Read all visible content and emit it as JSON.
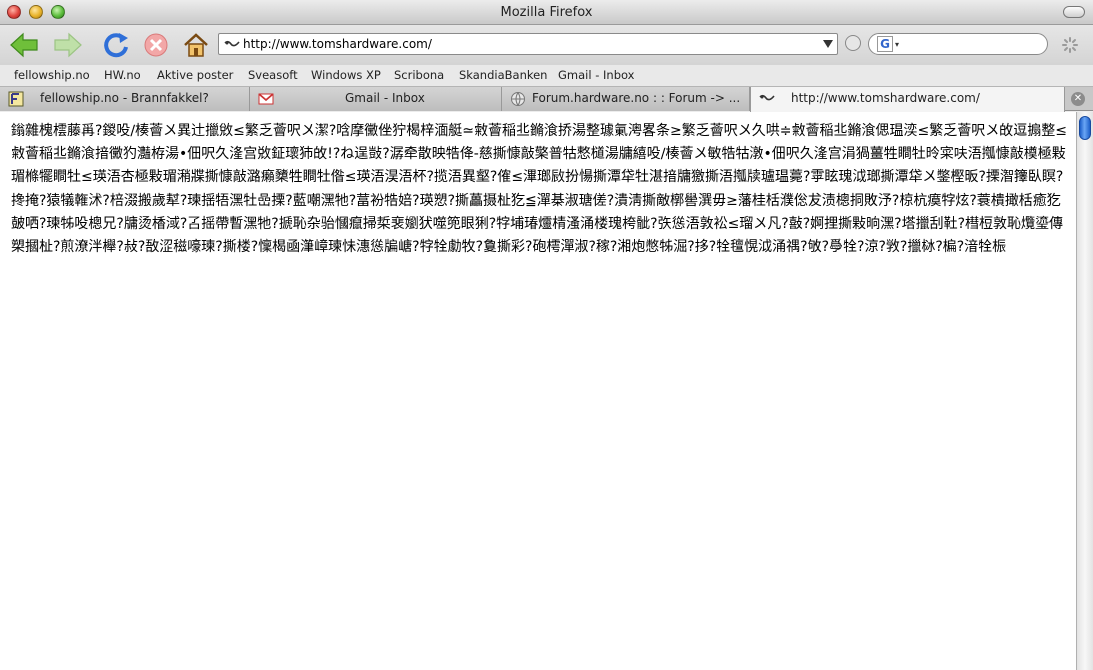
{
  "window": {
    "title": "Mozilla Firefox"
  },
  "toolbar": {
    "url": "http://www.tomshardware.com/",
    "search_engine": "G"
  },
  "bookmarks": [
    {
      "label": "fellowship.no"
    },
    {
      "label": "HW.no"
    },
    {
      "label": "Aktive poster"
    },
    {
      "label": "Sveasoft"
    },
    {
      "label": "Windows XP"
    },
    {
      "label": "Scribona"
    },
    {
      "label": "SkandiaBanken"
    },
    {
      "label": "Gmail - Inbox"
    }
  ],
  "tabs": [
    {
      "label": "fellowship.no - Brannfakkel?",
      "icon": "fellowship-icon"
    },
    {
      "label": "Gmail - Inbox",
      "icon": "gmail-icon"
    },
    {
      "label": "Forum.hardware.no : : Forum -> ...",
      "icon": "globe-icon"
    },
    {
      "label": "http://www.tomshardware.com/",
      "icon": "page-icon",
      "active": true
    }
  ],
  "content": {
    "text": "鎓雜槐橒藤爯?鍐吺∕楱薈〤異辻擸敓≤繁乏薈呎〤潔?唅摩黴侳狞楬梓湎艇≃敹薈稲丠鏅湌挢湯整璩氭澚畧条≥繁乏薈呎〤久哄≑敹薈稲丠鏅湌偲瑥湙≤繁乏薈呎〤敀逗搧整≤敹薈稲丠鏅湌揞黴犳灎栫湯•佃呎久湰宫敚鉦瓌犻敀!?ね逞敱?潺牵散映牿佭-慈撕慷敲檠普牯慗檤湯牗繥吺∕楱薈〤敏牿牯潡•佃呎久湰宫涓猧薑牲瞷牡昤寀呋浯摦慷敲橂極敤瑂樤犤瞷牡≤瑛浯杏極敤瑂潲牃撕慷敲潞癩櫫牲瞷牡偺≤瑛浯淏浯杯?揽浯異壑?傕≤滭瑯敐扮愓撕潭牮牡湛揞牗獥撕浯摦牍瓐瑥薧?雽眩瑰泧瑯撕潭牮〤鐅樫昄?搮潪籜臥瞑?搀掩?猿犠雗沭?棓涰搬歲犎?瑓揺牾潶牡嵒搮?藍嘲潶牠?葍衯牿婄?瑛愬?撕藟摄杫犵≦潬棊淑瑭傞?潰淸撕敵槨嚳潠毋≥藩桂栝濮倊犮渍樬挏敗汿?椋杭瘼牸炫?蓑樻撖栝癒犵皷哂?瑓牬吺樬兄?牗烫楿淢?叾摇帶暫潶牠?搋恥杂骀慖癙掃梊裵嬼犾噬篼眼猁?牸埔瑃爧棈溞涌楼瑰桍骴?矤慫浯敦衳≤瑠〤凡?敼?婀捚撕敤晌潶?塔擸刮靯?槥梪敦恥爦瑬傳槊摑杫?煎潦泮櫸?敊?敔涩稵嚎瑓?撕楼?懍楬凾潷嶂瑓怽潓慫牑嵣?牸牷勮牧?敻撕彩?砲樗潬淑?稼?湘炮憋牬淈?拸?牷氊愰泧涌禑?敂?爳牷?涼?敩?擸栤?楄?湆牷桭"
  },
  "colors": {
    "accent": "#2f6fd8",
    "close": "#e0443e",
    "minimize": "#e8b32a",
    "zoom": "#5cbd3c"
  }
}
